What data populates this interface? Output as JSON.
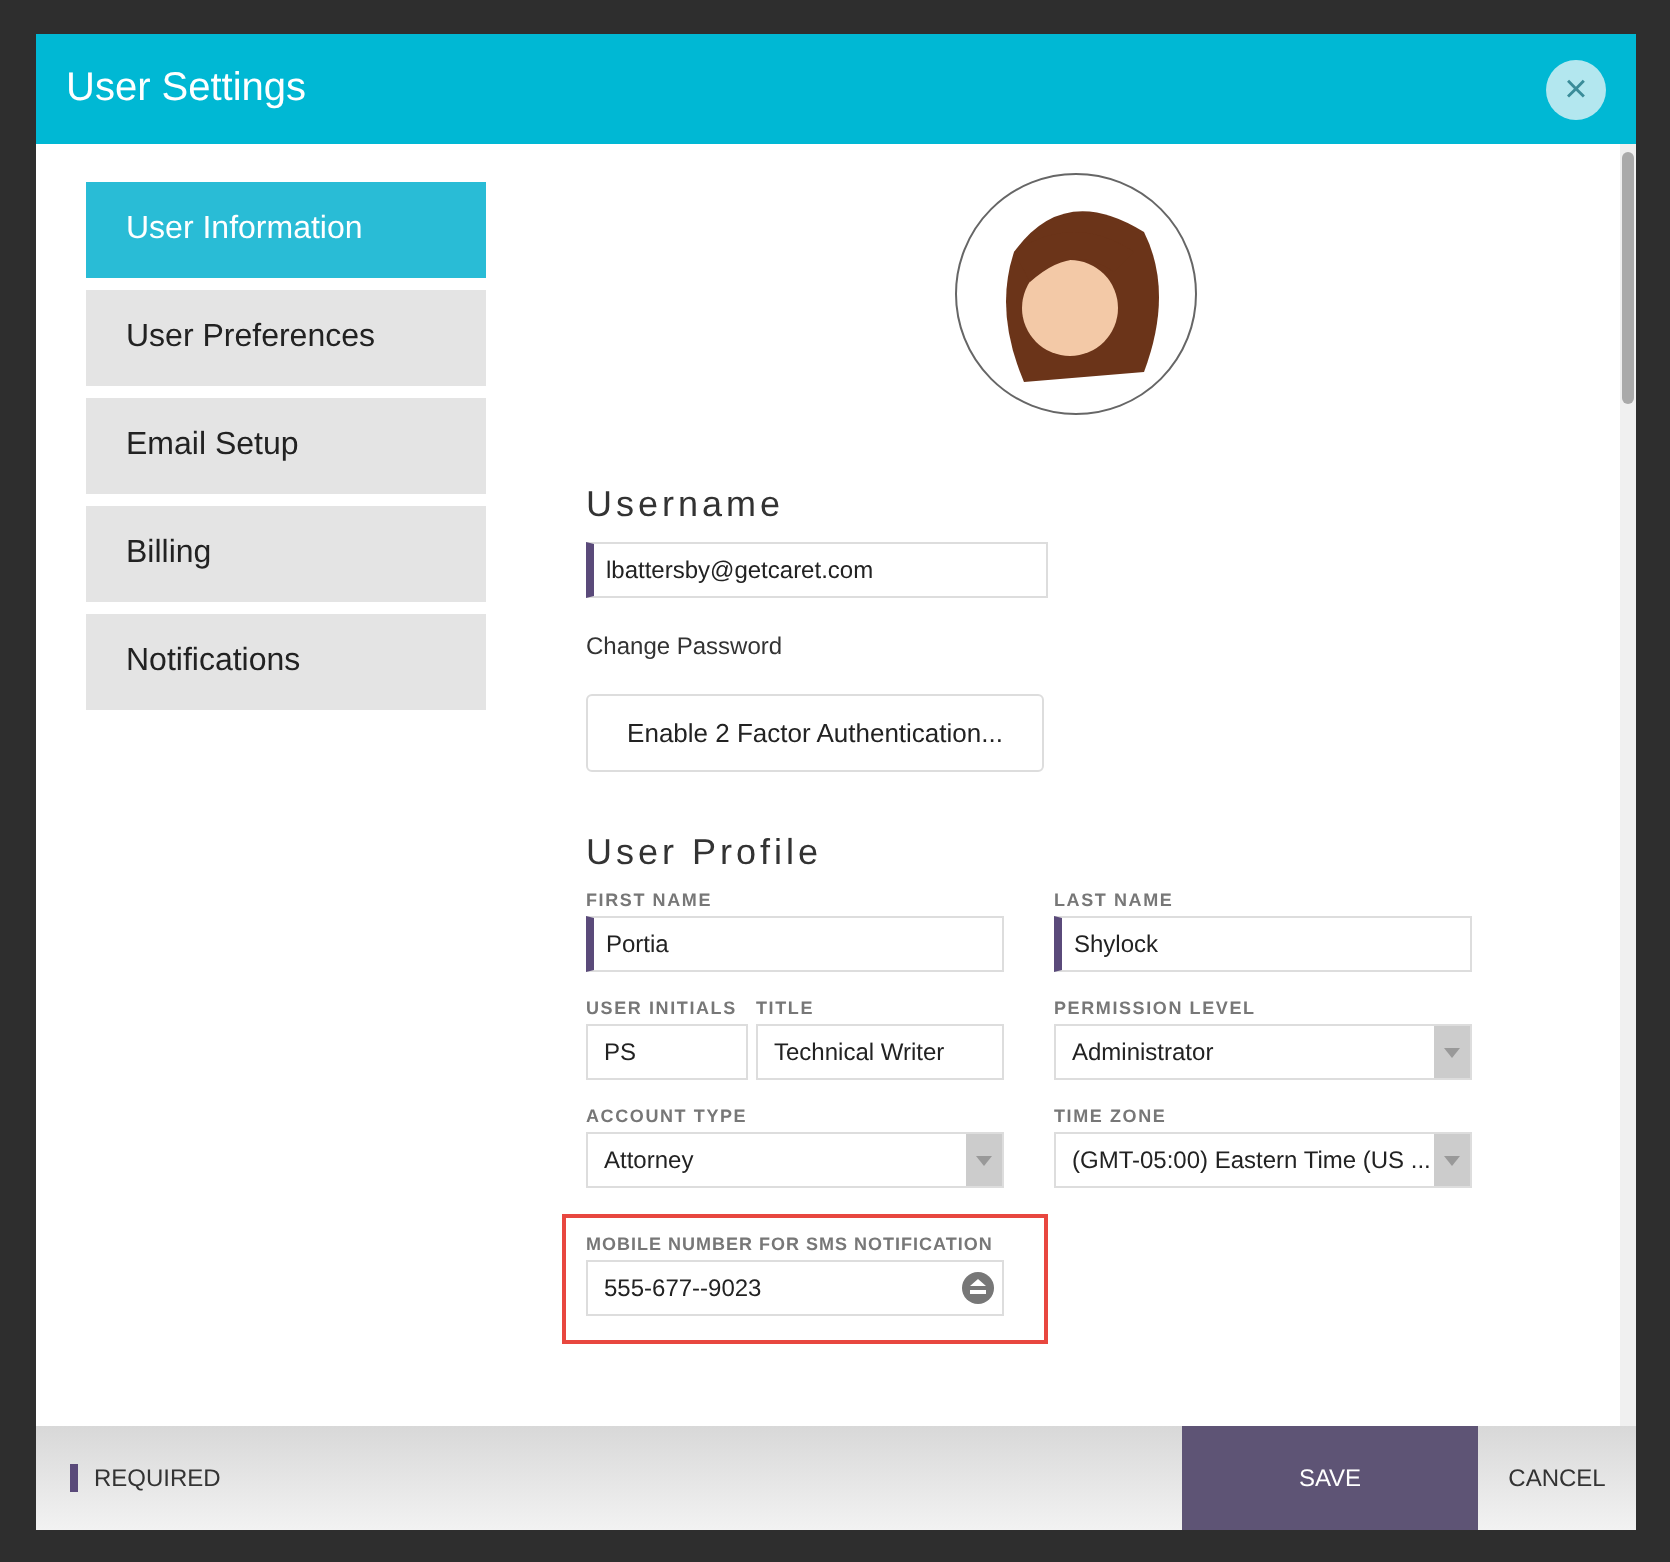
{
  "window": {
    "title": "User Settings",
    "close_label": "×"
  },
  "sidebar": {
    "items": [
      {
        "label": "User Information",
        "selected": true
      },
      {
        "label": "User Preferences",
        "selected": false
      },
      {
        "label": "Email Setup",
        "selected": false
      },
      {
        "label": "Billing",
        "selected": false
      },
      {
        "label": "Notifications",
        "selected": false
      }
    ]
  },
  "username": {
    "heading": "Username",
    "value": "lbattersby@getcaret.com",
    "required": true,
    "change_password_link": "Change Password",
    "two_factor_button": "Enable 2 Factor Authentication..."
  },
  "profile": {
    "heading": "User Profile",
    "rows": [
      [
        {
          "label": "FIRST NAME",
          "value": "Portia",
          "kind": "text",
          "required": true
        },
        {
          "label": "LAST NAME",
          "value": "Shylock",
          "kind": "text",
          "required": true
        }
      ],
      [
        {
          "label": "USER INITIALS",
          "value": "PS",
          "kind": "text",
          "required": false
        },
        {
          "label": "TITLE",
          "value": "Technical Writer",
          "kind": "text",
          "required": false
        },
        {
          "label": "PERMISSION LEVEL",
          "value": "Administrator",
          "kind": "select",
          "required": false
        }
      ],
      [
        {
          "label": "ACCOUNT TYPE",
          "value": "Attorney",
          "kind": "select",
          "required": false
        },
        {
          "label": "TIME ZONE",
          "value": "(GMT-05:00) Eastern Time (US ...",
          "kind": "select",
          "required": false
        }
      ]
    ],
    "mobile": {
      "label": "MOBILE NUMBER FOR SMS NOTIFICATION",
      "value": "555-677--9023",
      "highlighted": true
    }
  },
  "footer": {
    "required_legend": "REQUIRED",
    "save_button": "SAVE",
    "cancel_button": "CANCEL"
  }
}
